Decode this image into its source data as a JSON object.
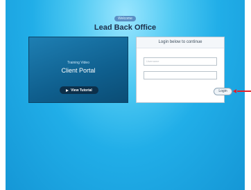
{
  "header": {
    "badge": "Welcome",
    "title": "Lead Back Office"
  },
  "video": {
    "subtitle": "Training Video",
    "title": "Client Portal",
    "button_label": "View Tutorial"
  },
  "login": {
    "header": "Login below to continue",
    "username_placeholder": "Username",
    "password_placeholder": "",
    "button_label": "Login"
  },
  "colors": {
    "background": "#21aee8",
    "arrow": "#e0202a",
    "panel_dark": "#0f5f8e"
  },
  "icons": {
    "play": "play-icon",
    "arrow": "red-arrow-pointer"
  }
}
